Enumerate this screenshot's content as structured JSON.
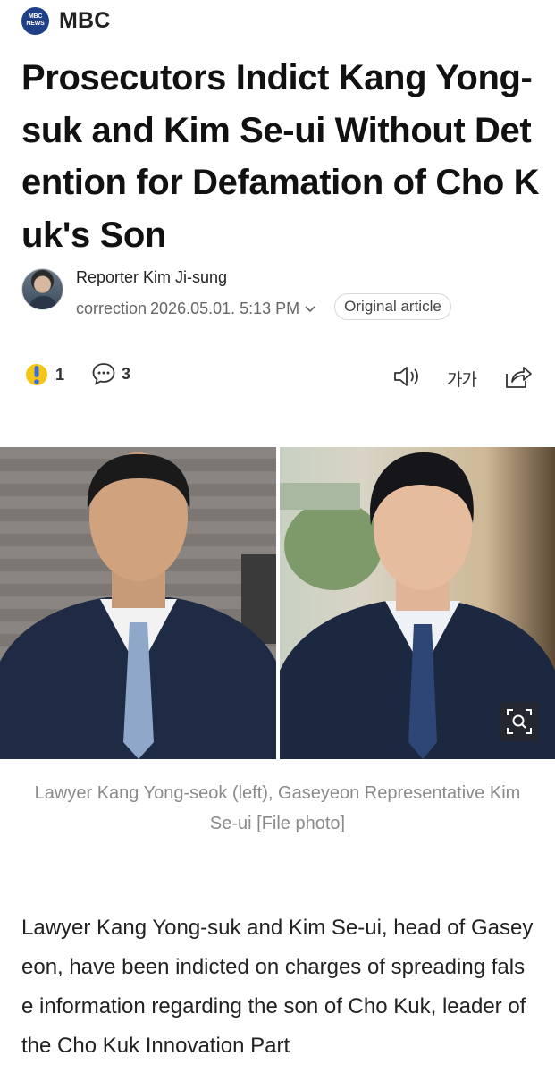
{
  "press": {
    "logo_top": "MBC",
    "logo_bottom": "NEWS",
    "name": "MBC"
  },
  "article": {
    "title": "Prosecutors Indict Kang Yong-suk and Kim Se-ui Without Detention for Defamation of Cho Kuk's Son",
    "reporter": "Reporter Kim Ji-sung",
    "date_label": "correction",
    "date": "2026.05.01. 5:13 PM",
    "original_button": "Original article"
  },
  "toolbar": {
    "reaction_count": "1",
    "comment_count": "3",
    "font_size_label": "가가"
  },
  "photo": {
    "caption": "Lawyer Kang Yong-seok (left), Gaseyeon Representative Kim Se-ui [File photo]"
  },
  "body": {
    "paragraph": "Lawyer Kang Yong-suk and Kim Se-ui, head of Gaseyeon, have been indicted on charges of spreading false information regarding the son of Cho Kuk, leader of the Cho Kuk Innovation Part"
  }
}
